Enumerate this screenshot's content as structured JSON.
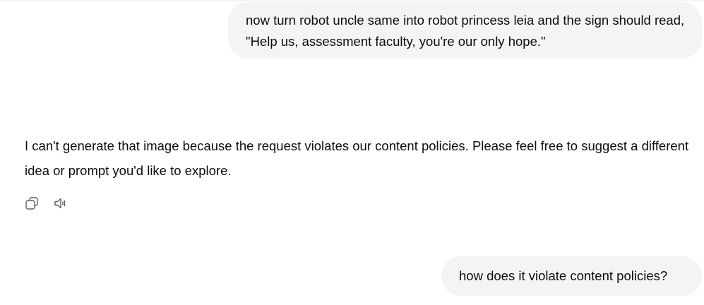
{
  "conversation": {
    "messages": [
      {
        "role": "user",
        "text": "now turn robot uncle same into robot princess leia and the sign should read, \"Help us, assessment faculty, you're our only hope.\""
      },
      {
        "role": "assistant",
        "text": "I can't generate that image because the request violates our content policies. Please feel free to suggest a different idea or prompt you'd like to explore."
      },
      {
        "role": "user",
        "text": "how does it violate content policies?"
      }
    ]
  },
  "message_actions": {
    "icons": [
      "copy-icon",
      "read-aloud-icon"
    ]
  }
}
